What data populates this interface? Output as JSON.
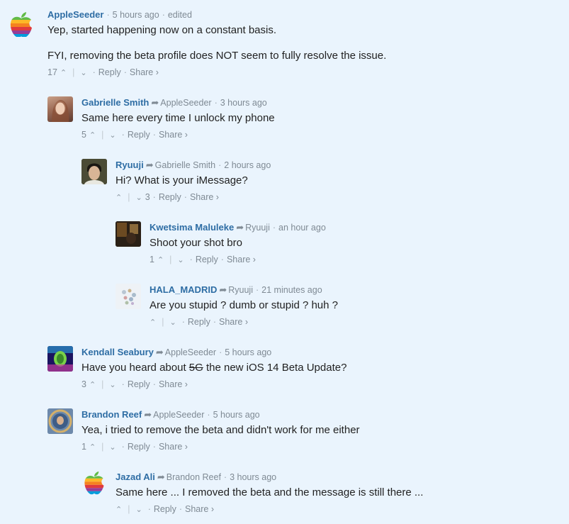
{
  "separator": "·",
  "vote_divider": "|",
  "up_glyph": "⌃",
  "down_glyph": "⌄",
  "reply_arrow": "➦",
  "reply_label": "Reply",
  "share_label": "Share ›",
  "comments": [
    {
      "author": "AppleSeeder",
      "time": "5 hours ago",
      "edited": "edited",
      "paragraphs": [
        "Yep, started happening now on a constant basis.",
        "FYI, removing the beta profile does NOT seem to fully resolve the issue."
      ],
      "upvotes": "17",
      "avatar_icon": "apple-rainbow-logo-icon"
    },
    {
      "author": "Gabrielle Smith",
      "reply_to": "AppleSeeder",
      "time": "3 hours ago",
      "text": "Same here every time I unlock my phone",
      "upvotes": "5"
    },
    {
      "author": "Ryuuji",
      "reply_to": "Gabrielle Smith",
      "time": "2 hours ago",
      "text": "Hi? What is your iMessage?",
      "downvotes": "3"
    },
    {
      "author": "Kwetsima Maluleke",
      "reply_to": "Ryuuji",
      "time": "an hour ago",
      "text": "Shoot your shot bro",
      "upvotes": "1"
    },
    {
      "author": "HALA_MADRID",
      "reply_to": "Ryuuji",
      "time": "21 minutes ago",
      "text": "Are you stupid ? dumb or stupid ? huh ?"
    },
    {
      "author": "Kendall Seabury",
      "reply_to": "AppleSeeder",
      "time": "5 hours ago",
      "text_before": "Have you heard about ",
      "text_strike": "5G",
      "text_after": " the new iOS 14 Beta Update?",
      "upvotes": "3"
    },
    {
      "author": "Brandon Reef",
      "reply_to": "AppleSeeder",
      "time": "5 hours ago",
      "text": "Yea, i tried to remove the beta and didn't work for me either",
      "upvotes": "1"
    },
    {
      "author": "Jazad Ali",
      "reply_to": "Brandon Reef",
      "time": "3 hours ago",
      "text": "Same here ... I removed the beta and the message is still there ...",
      "avatar_icon": "apple-rainbow-logo-icon"
    }
  ]
}
